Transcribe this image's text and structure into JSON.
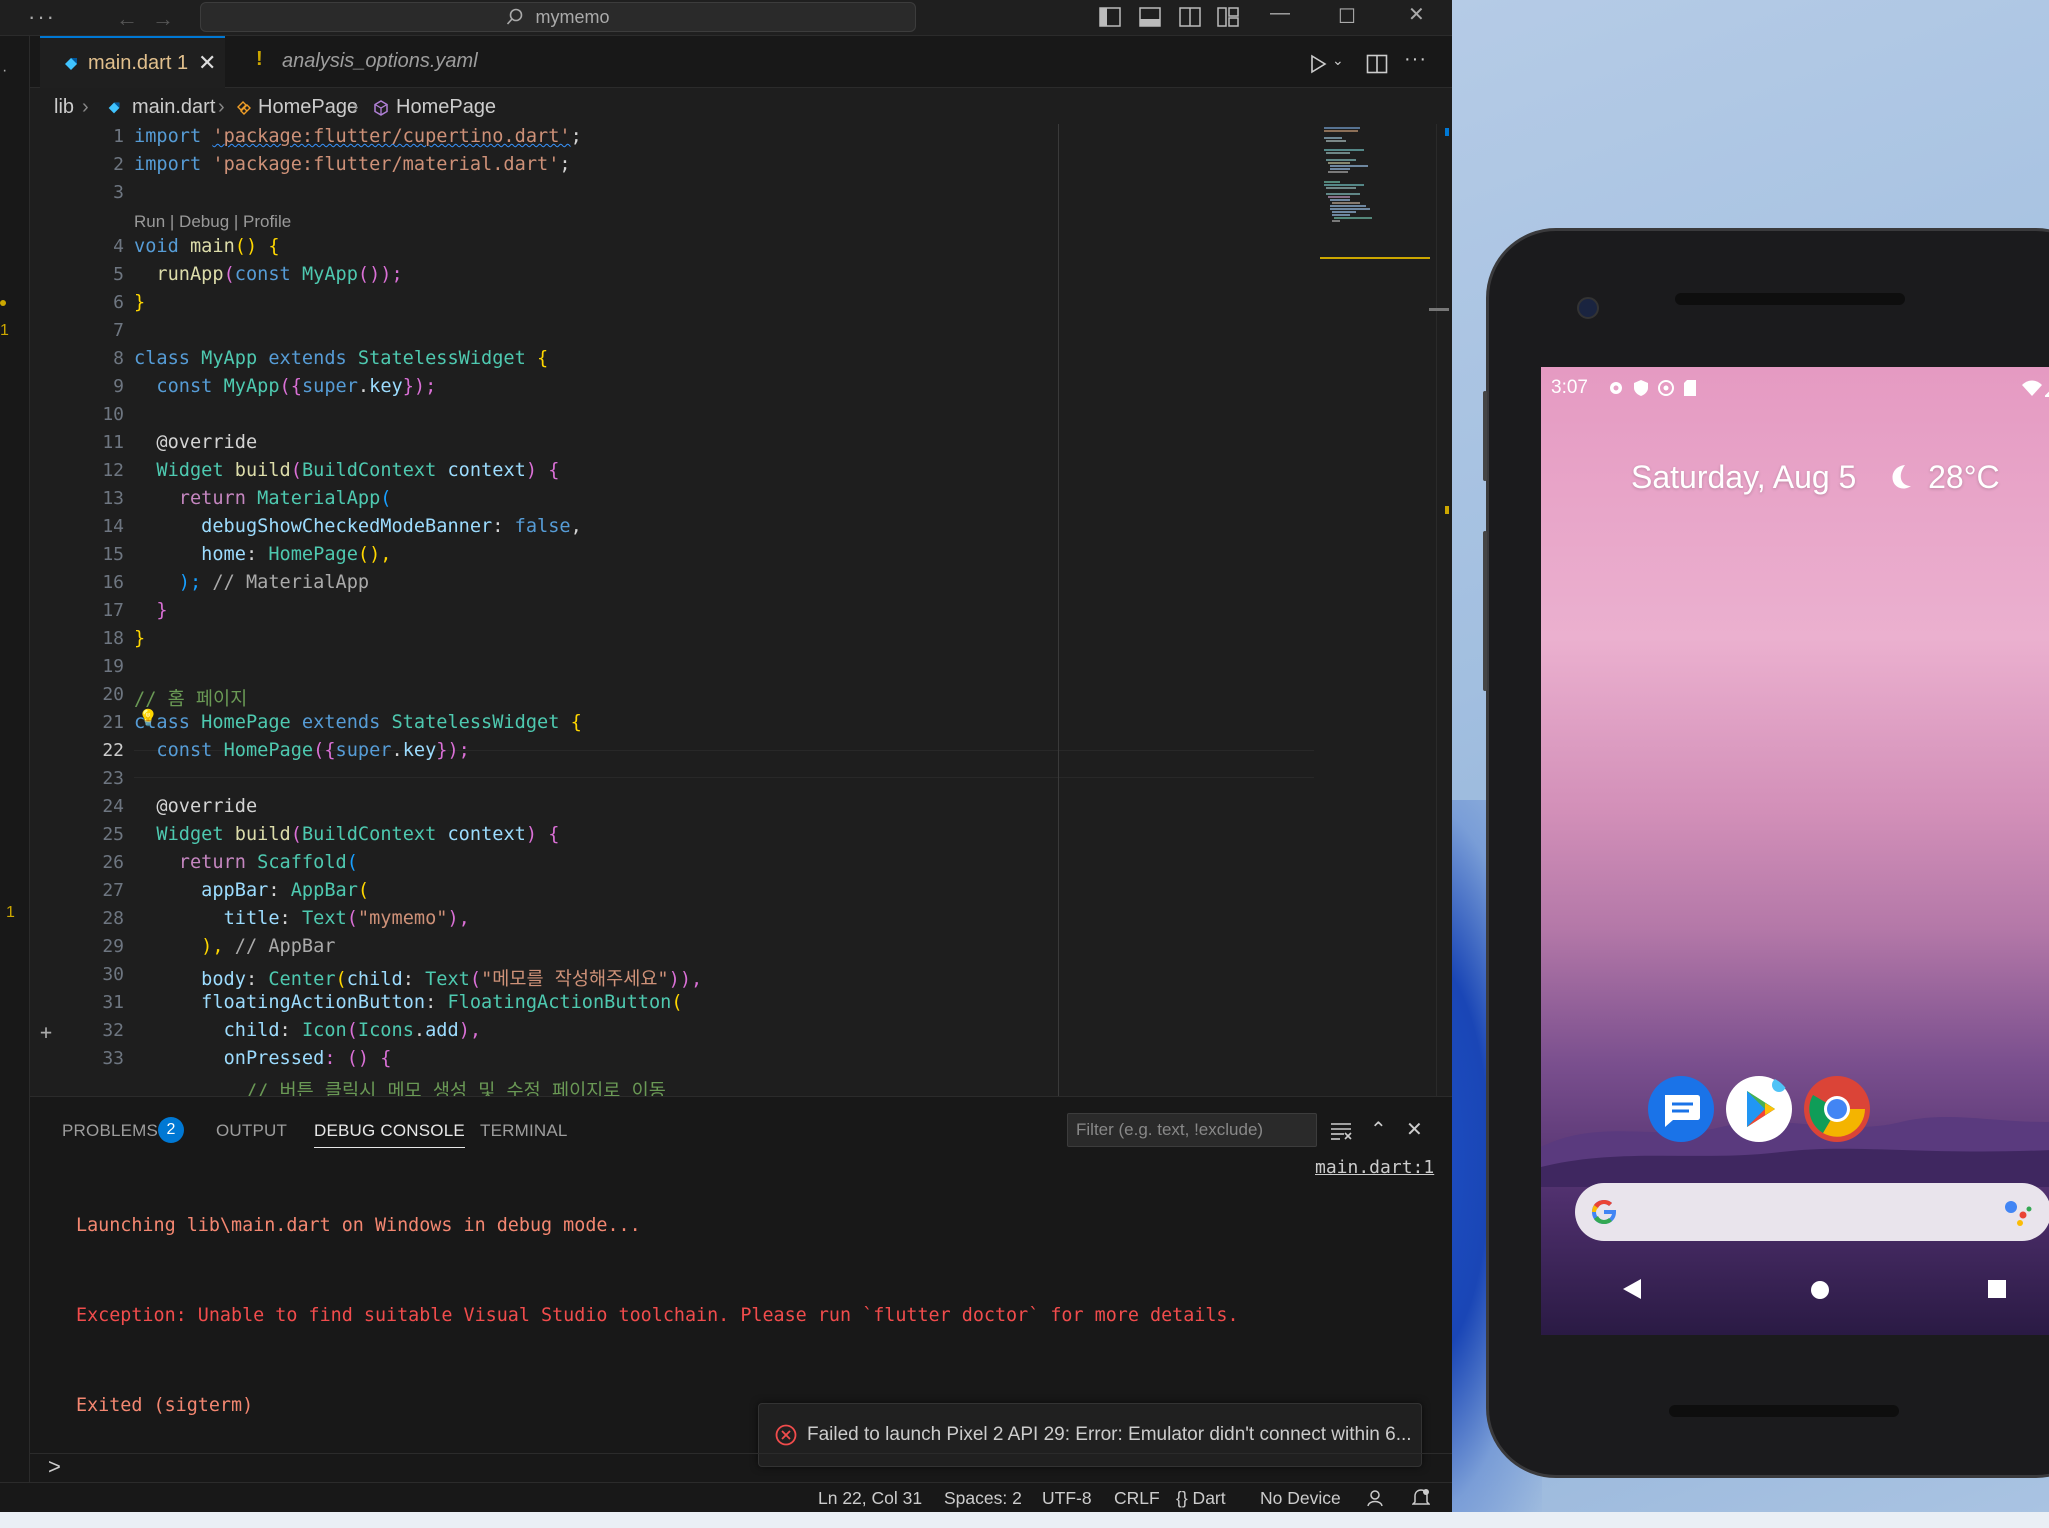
{
  "titlebar": {
    "more": "···",
    "search_text": "mymemo"
  },
  "tabs": [
    {
      "label": "main.dart",
      "badge": "1",
      "close": "✕"
    },
    {
      "label": "analysis_options.yaml",
      "warn": "!"
    }
  ],
  "breadcrumb": {
    "folder": "lib",
    "file": "main.dart",
    "cls": "HomePage",
    "ctor": "HomePage"
  },
  "code_lens": "Run | Debug | Profile",
  "line_numbers": [
    "1",
    "2",
    "3",
    "4",
    "5",
    "6",
    "7",
    "8",
    "9",
    "10",
    "11",
    "12",
    "13",
    "14",
    "15",
    "16",
    "17",
    "18",
    "19",
    "20",
    "21",
    "22",
    "23",
    "24",
    "25",
    "26",
    "27",
    "28",
    "29",
    "30",
    "31",
    "32",
    "33"
  ],
  "code": {
    "l1_a": "import ",
    "l1_b": "'package:flutter/cupertino.dart'",
    "l1_c": ";",
    "l2_a": "import ",
    "l2_b": "'package:flutter/material.dart'",
    "l2_c": ";",
    "l4_a": "void ",
    "l4_b": "main",
    "l4_c": "() {",
    "l5_a": "  ",
    "l5_b": "runApp",
    "l5_c": "(",
    "l5_d": "const ",
    "l5_e": "MyApp",
    "l5_f": "());",
    "l6": "}",
    "l8_a": "class ",
    "l8_b": "MyApp ",
    "l8_c": "extends ",
    "l8_d": "StatelessWidget ",
    "l8_e": "{",
    "l9_a": "  const ",
    "l9_b": "MyApp",
    "l9_c": "({",
    "l9_d": "super",
    "l9_e": ".",
    "l9_f": "key",
    "l9_g": "});",
    "l11": "  @override",
    "l12_a": "  ",
    "l12_b": "Widget ",
    "l12_c": "build",
    "l12_d": "(",
    "l12_e": "BuildContext ",
    "l12_f": "context",
    "l12_g": ") {",
    "l13_a": "    ",
    "l13_b": "return ",
    "l13_c": "MaterialApp",
    "l13_d": "(",
    "l14_a": "      ",
    "l14_b": "debugShowCheckedModeBanner",
    "l14_c": ": ",
    "l14_d": "false",
    "l14_e": ",",
    "l15_a": "      ",
    "l15_b": "home",
    "l15_c": ": ",
    "l15_d": "HomePage",
    "l15_e": "(),",
    "l16_a": "    ); ",
    "l16_b": "// MaterialApp",
    "l17": "  }",
    "l18": "}",
    "l20": "// 홈 페이지",
    "l21_a": "class ",
    "l21_b": "HomePage ",
    "l21_c": "extends ",
    "l21_d": "StatelessWidget ",
    "l21_e": "{",
    "l22_a": "  const ",
    "l22_b": "HomePage",
    "l22_c": "({",
    "l22_d": "super",
    "l22_e": ".",
    "l22_f": "key",
    "l22_g": "});",
    "l24": "  @override",
    "l25_a": "  ",
    "l25_b": "Widget ",
    "l25_c": "build",
    "l25_d": "(",
    "l25_e": "BuildContext ",
    "l25_f": "context",
    "l25_g": ") {",
    "l26_a": "    ",
    "l26_b": "return ",
    "l26_c": "Scaffold",
    "l26_d": "(",
    "l27_a": "      ",
    "l27_b": "appBar",
    "l27_c": ": ",
    "l27_d": "AppBar",
    "l27_e": "(",
    "l28_a": "        ",
    "l28_b": "title",
    "l28_c": ": ",
    "l28_d": "Text",
    "l28_e": "(",
    "l28_f": "\"mymemo\"",
    "l28_g": "),",
    "l29_a": "      ), ",
    "l29_b": "// AppBar",
    "l30_a": "      ",
    "l30_b": "body",
    "l30_c": ": ",
    "l30_d": "Center",
    "l30_e": "(",
    "l30_f": "child",
    "l30_g": ": ",
    "l30_h": "Text",
    "l30_i": "(",
    "l30_j": "\"메모를 작성해주세요\"",
    "l30_k": ")),",
    "l31_a": "      ",
    "l31_b": "floatingActionButton",
    "l31_c": ": ",
    "l31_d": "FloatingActionButton",
    "l31_e": "(",
    "l32_a": "        ",
    "l32_b": "child",
    "l32_c": ": ",
    "l32_d": "Icon",
    "l32_e": "(",
    "l32_f": "Icons",
    "l32_g": ".",
    "l32_h": "add",
    "l32_i": "),",
    "l33_a": "        ",
    "l33_b": "onPressed",
    "l33_c": ": () {",
    "l34": "          // 버튼 클릭시 메모 생성 및 수정 페이지로 이동"
  },
  "panel": {
    "tabs": [
      "PROBLEMS",
      "OUTPUT",
      "DEBUG CONSOLE",
      "TERMINAL"
    ],
    "problems_count": "2",
    "filter_placeholder": "Filter (e.g. text, !exclude)",
    "console": [
      "Launching lib\\main.dart on Windows in debug mode...",
      "Exception: Unable to find suitable Visual Studio toolchain. Please run `flutter doctor` for more details.",
      "Exited (sigterm)"
    ],
    "source_link": "main.dart:1",
    "toast": "Failed to launch Pixel 2 API 29: Error: Emulator didn't connect within 6...",
    "repl_prompt": ">"
  },
  "statusbar": {
    "position": "Ln 22, Col 31",
    "spaces": "Spaces: 2",
    "encoding": "UTF-8",
    "eol": "CRLF",
    "language": "{} Dart",
    "device": "No Device"
  },
  "gutter_markers": {
    "m1": "1",
    "m2": "1",
    "plus": "+"
  },
  "emulator": {
    "time": "3:07",
    "date": "Saturday, Aug 5",
    "temperature": "28°C"
  },
  "colors": {
    "accent": "#0078d4",
    "error": "#f14c4c",
    "warning": "#cca700"
  }
}
